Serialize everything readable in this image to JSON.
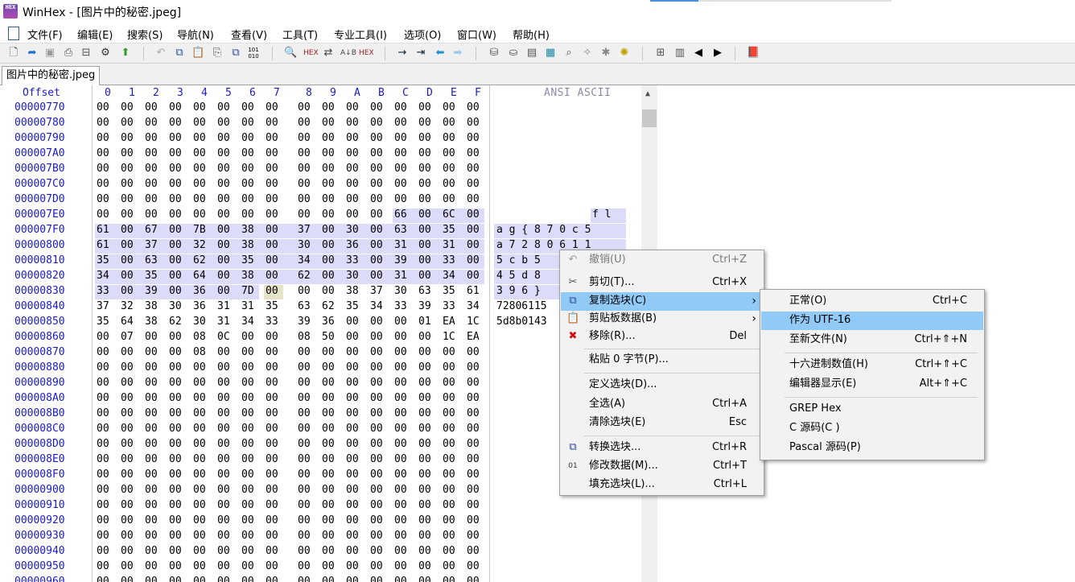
{
  "window": {
    "title": "WinHex - [图片中的秘密.jpeg]",
    "app_icon_text": "HEX"
  },
  "menu": [
    "文件(F)",
    "编辑(E)",
    "搜索(S)",
    "导航(N)",
    "查看(V)",
    "工具(T)",
    "专业工具(I)",
    "选项(O)",
    "窗口(W)",
    "帮助(H)"
  ],
  "toolbar_icons": [
    "new-file-icon",
    "open-icon",
    "save-icon",
    "print-icon",
    "properties-icon",
    "settings-icon",
    "upload-icon",
    "undo-icon",
    "copy-block-icon",
    "clipboard-icon",
    "paste-icon",
    "write-clipboard-icon",
    "binary-icon",
    "find-icon",
    "find-hex-icon",
    "replace-icon",
    "replace-hex-icon",
    "goto-icon",
    "goto-offset-icon",
    "back-icon",
    "forward-icon",
    "disk-icon",
    "open-disk-icon",
    "ram-icon",
    "calculator-icon",
    "zoom-icon",
    "tools-icon",
    "gear-icon",
    "list-icon",
    "table-icon",
    "prev-icon",
    "next-icon",
    "book-icon"
  ],
  "tab": {
    "label": "图片中的秘密.jpeg"
  },
  "editor": {
    "offset_header": "Offset",
    "hex_columns": [
      "0",
      "1",
      "2",
      "3",
      "4",
      "5",
      "6",
      "7",
      "8",
      "9",
      "A",
      "B",
      "C",
      "D",
      "E",
      "F"
    ],
    "ansi_header": "ANSI ASCII",
    "rows": [
      {
        "offset": "00000770",
        "bytes": [
          "00",
          "00",
          "00",
          "00",
          "00",
          "00",
          "00",
          "00",
          "00",
          "00",
          "00",
          "00",
          "00",
          "00",
          "00",
          "00"
        ],
        "ansi": ""
      },
      {
        "offset": "00000780",
        "bytes": [
          "00",
          "00",
          "00",
          "00",
          "00",
          "00",
          "00",
          "00",
          "00",
          "00",
          "00",
          "00",
          "00",
          "00",
          "00",
          "00"
        ],
        "ansi": ""
      },
      {
        "offset": "00000790",
        "bytes": [
          "00",
          "00",
          "00",
          "00",
          "00",
          "00",
          "00",
          "00",
          "00",
          "00",
          "00",
          "00",
          "00",
          "00",
          "00",
          "00"
        ],
        "ansi": ""
      },
      {
        "offset": "000007A0",
        "bytes": [
          "00",
          "00",
          "00",
          "00",
          "00",
          "00",
          "00",
          "00",
          "00",
          "00",
          "00",
          "00",
          "00",
          "00",
          "00",
          "00"
        ],
        "ansi": ""
      },
      {
        "offset": "000007B0",
        "bytes": [
          "00",
          "00",
          "00",
          "00",
          "00",
          "00",
          "00",
          "00",
          "00",
          "00",
          "00",
          "00",
          "00",
          "00",
          "00",
          "00"
        ],
        "ansi": ""
      },
      {
        "offset": "000007C0",
        "bytes": [
          "00",
          "00",
          "00",
          "00",
          "00",
          "00",
          "00",
          "00",
          "00",
          "00",
          "00",
          "00",
          "00",
          "00",
          "00",
          "00"
        ],
        "ansi": ""
      },
      {
        "offset": "000007D0",
        "bytes": [
          "00",
          "00",
          "00",
          "00",
          "00",
          "00",
          "00",
          "00",
          "00",
          "00",
          "00",
          "00",
          "00",
          "00",
          "00",
          "00"
        ],
        "ansi": ""
      },
      {
        "offset": "000007E0",
        "bytes": [
          "00",
          "00",
          "00",
          "00",
          "00",
          "00",
          "00",
          "00",
          "00",
          "00",
          "00",
          "00",
          "66",
          "00",
          "6C",
          "00"
        ],
        "ansi": "f l"
      },
      {
        "offset": "000007F0",
        "bytes": [
          "61",
          "00",
          "67",
          "00",
          "7B",
          "00",
          "38",
          "00",
          "37",
          "00",
          "30",
          "00",
          "63",
          "00",
          "35",
          "00"
        ],
        "ansi": "a g { 8 7 0 c 5"
      },
      {
        "offset": "00000800",
        "bytes": [
          "61",
          "00",
          "37",
          "00",
          "32",
          "00",
          "38",
          "00",
          "30",
          "00",
          "36",
          "00",
          "31",
          "00",
          "31",
          "00"
        ],
        "ansi": "a 7 2 8 0 6 1 1"
      },
      {
        "offset": "00000810",
        "bytes": [
          "35",
          "00",
          "63",
          "00",
          "62",
          "00",
          "35",
          "00",
          "34",
          "00",
          "33",
          "00",
          "39",
          "00",
          "33",
          "00"
        ],
        "ansi": "5 c b 5"
      },
      {
        "offset": "00000820",
        "bytes": [
          "34",
          "00",
          "35",
          "00",
          "64",
          "00",
          "38",
          "00",
          "62",
          "00",
          "30",
          "00",
          "31",
          "00",
          "34",
          "00"
        ],
        "ansi": "4 5 d 8"
      },
      {
        "offset": "00000830",
        "bytes": [
          "33",
          "00",
          "39",
          "00",
          "36",
          "00",
          "7D",
          "00",
          "00",
          "00",
          "38",
          "37",
          "30",
          "63",
          "35",
          "61"
        ],
        "ansi": "3 9 6 }"
      },
      {
        "offset": "00000840",
        "bytes": [
          "37",
          "32",
          "38",
          "30",
          "36",
          "31",
          "31",
          "35",
          "63",
          "62",
          "35",
          "34",
          "33",
          "39",
          "33",
          "34"
        ],
        "ansi": "72806115"
      },
      {
        "offset": "00000850",
        "bytes": [
          "35",
          "64",
          "38",
          "62",
          "30",
          "31",
          "34",
          "33",
          "39",
          "36",
          "00",
          "00",
          "00",
          "01",
          "EA",
          "1C"
        ],
        "ansi": "5d8b0143"
      },
      {
        "offset": "00000860",
        "bytes": [
          "00",
          "07",
          "00",
          "00",
          "08",
          "0C",
          "00",
          "00",
          "08",
          "50",
          "00",
          "00",
          "00",
          "00",
          "1C",
          "EA"
        ],
        "ansi": ""
      },
      {
        "offset": "00000870",
        "bytes": [
          "00",
          "00",
          "00",
          "00",
          "08",
          "00",
          "00",
          "00",
          "00",
          "00",
          "00",
          "00",
          "00",
          "00",
          "00",
          "00"
        ],
        "ansi": ""
      },
      {
        "offset": "00000880",
        "bytes": [
          "00",
          "00",
          "00",
          "00",
          "00",
          "00",
          "00",
          "00",
          "00",
          "00",
          "00",
          "00",
          "00",
          "00",
          "00",
          "00"
        ],
        "ansi": ""
      },
      {
        "offset": "00000890",
        "bytes": [
          "00",
          "00",
          "00",
          "00",
          "00",
          "00",
          "00",
          "00",
          "00",
          "00",
          "00",
          "00",
          "00",
          "00",
          "00",
          "00"
        ],
        "ansi": ""
      },
      {
        "offset": "000008A0",
        "bytes": [
          "00",
          "00",
          "00",
          "00",
          "00",
          "00",
          "00",
          "00",
          "00",
          "00",
          "00",
          "00",
          "00",
          "00",
          "00",
          "00"
        ],
        "ansi": ""
      },
      {
        "offset": "000008B0",
        "bytes": [
          "00",
          "00",
          "00",
          "00",
          "00",
          "00",
          "00",
          "00",
          "00",
          "00",
          "00",
          "00",
          "00",
          "00",
          "00",
          "00"
        ],
        "ansi": ""
      },
      {
        "offset": "000008C0",
        "bytes": [
          "00",
          "00",
          "00",
          "00",
          "00",
          "00",
          "00",
          "00",
          "00",
          "00",
          "00",
          "00",
          "00",
          "00",
          "00",
          "00"
        ],
        "ansi": ""
      },
      {
        "offset": "000008D0",
        "bytes": [
          "00",
          "00",
          "00",
          "00",
          "00",
          "00",
          "00",
          "00",
          "00",
          "00",
          "00",
          "00",
          "00",
          "00",
          "00",
          "00"
        ],
        "ansi": ""
      },
      {
        "offset": "000008E0",
        "bytes": [
          "00",
          "00",
          "00",
          "00",
          "00",
          "00",
          "00",
          "00",
          "00",
          "00",
          "00",
          "00",
          "00",
          "00",
          "00",
          "00"
        ],
        "ansi": ""
      },
      {
        "offset": "000008F0",
        "bytes": [
          "00",
          "00",
          "00",
          "00",
          "00",
          "00",
          "00",
          "00",
          "00",
          "00",
          "00",
          "00",
          "00",
          "00",
          "00",
          "00"
        ],
        "ansi": ""
      },
      {
        "offset": "00000900",
        "bytes": [
          "00",
          "00",
          "00",
          "00",
          "00",
          "00",
          "00",
          "00",
          "00",
          "00",
          "00",
          "00",
          "00",
          "00",
          "00",
          "00"
        ],
        "ansi": ""
      },
      {
        "offset": "00000910",
        "bytes": [
          "00",
          "00",
          "00",
          "00",
          "00",
          "00",
          "00",
          "00",
          "00",
          "00",
          "00",
          "00",
          "00",
          "00",
          "00",
          "00"
        ],
        "ansi": ""
      },
      {
        "offset": "00000920",
        "bytes": [
          "00",
          "00",
          "00",
          "00",
          "00",
          "00",
          "00",
          "00",
          "00",
          "00",
          "00",
          "00",
          "00",
          "00",
          "00",
          "00"
        ],
        "ansi": ""
      },
      {
        "offset": "00000930",
        "bytes": [
          "00",
          "00",
          "00",
          "00",
          "00",
          "00",
          "00",
          "00",
          "00",
          "00",
          "00",
          "00",
          "00",
          "00",
          "00",
          "00"
        ],
        "ansi": ""
      },
      {
        "offset": "00000940",
        "bytes": [
          "00",
          "00",
          "00",
          "00",
          "00",
          "00",
          "00",
          "00",
          "00",
          "00",
          "00",
          "00",
          "00",
          "00",
          "00",
          "00"
        ],
        "ansi": ""
      },
      {
        "offset": "00000950",
        "bytes": [
          "00",
          "00",
          "00",
          "00",
          "00",
          "00",
          "00",
          "00",
          "00",
          "00",
          "00",
          "00",
          "00",
          "00",
          "00",
          "00"
        ],
        "ansi": ""
      },
      {
        "offset": "00000960",
        "bytes": [
          "00",
          "00",
          "00",
          "00",
          "00",
          "00",
          "00",
          "00",
          "00",
          "00",
          "00",
          "00",
          "00",
          "00",
          "00",
          "00"
        ],
        "ansi": ""
      }
    ]
  },
  "context_menu": {
    "items": [
      {
        "label": "撤销(U)",
        "shortcut": "Ctrl+Z",
        "icon": "undo-icon",
        "disabled": true
      },
      {
        "label": "剪切(T)...",
        "shortcut": "Ctrl+X",
        "icon": "cut-icon"
      },
      {
        "label": "复制选块(C)",
        "shortcut": "",
        "icon": "copy-block-icon",
        "highlight": true,
        "submenu": true
      },
      {
        "label": "剪贴板数据(B)",
        "shortcut": "",
        "icon": "clipboard-icon",
        "submenu": true
      },
      {
        "label": "移除(R)...",
        "shortcut": "Del",
        "icon": "remove-icon"
      },
      {
        "label": "粘贴 0 字节(P)...",
        "shortcut": "",
        "icon": ""
      },
      {
        "label": "定义选块(D)...",
        "shortcut": "",
        "icon": ""
      },
      {
        "label": "全选(A)",
        "shortcut": "Ctrl+A",
        "icon": ""
      },
      {
        "label": "清除选块(E)",
        "shortcut": "Esc",
        "icon": ""
      },
      {
        "label": "转换选块...",
        "shortcut": "Ctrl+R",
        "icon": "convert-icon"
      },
      {
        "label": "修改数据(M)...",
        "shortcut": "Ctrl+T",
        "icon": "binary-icon"
      },
      {
        "label": "填充选块(L)...",
        "shortcut": "Ctrl+L",
        "icon": ""
      }
    ]
  },
  "submenu": {
    "items": [
      {
        "label": "正常(O)",
        "shortcut": "Ctrl+C"
      },
      {
        "label": "作为 UTF-16",
        "shortcut": "",
        "highlight": true
      },
      {
        "label": "至新文件(N)",
        "shortcut": "Ctrl+⇑+N"
      },
      {
        "label": "十六进制数值(H)",
        "shortcut": "Ctrl+⇑+C"
      },
      {
        "label": "编辑器显示(E)",
        "shortcut": "Alt+⇑+C"
      },
      {
        "label": "GREP Hex",
        "shortcut": ""
      },
      {
        "label": "C 源码(C )",
        "shortcut": ""
      },
      {
        "label": "Pascal 源码(P)",
        "shortcut": ""
      }
    ]
  }
}
